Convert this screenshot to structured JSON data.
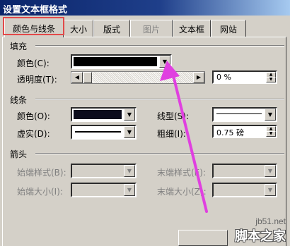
{
  "window": {
    "title": "设置文本框格式"
  },
  "tabs": [
    {
      "label": "颜色与线条",
      "active": true
    },
    {
      "label": "大小"
    },
    {
      "label": "版式"
    },
    {
      "label": "图片",
      "disabled": true
    },
    {
      "label": "文本框"
    },
    {
      "label": "网站"
    }
  ],
  "fill": {
    "section_label": "填充",
    "color_label": "颜色(C):",
    "color_value": "#000000",
    "transparency_label": "透明度(T):",
    "transparency_value": "0 %"
  },
  "line": {
    "section_label": "线条",
    "color_label": "颜色(O):",
    "color_value": "#000000",
    "dash_label": "虚实(D):",
    "style_label": "线型(S):",
    "weight_label": "粗细(I):",
    "weight_value": "0.75 磅"
  },
  "arrows": {
    "section_label": "箭头",
    "begin_style_label": "始端样式(B):",
    "begin_size_label": "始端大小(I):",
    "end_style_label": "末端样式(E):",
    "end_size_label": "末端大小(Z):"
  },
  "annotation": {
    "highlight_color": "#e24a4a",
    "arrow_color": "#e040e0"
  },
  "watermark": {
    "domain": "jb51.net",
    "brand": "脚本之家"
  }
}
